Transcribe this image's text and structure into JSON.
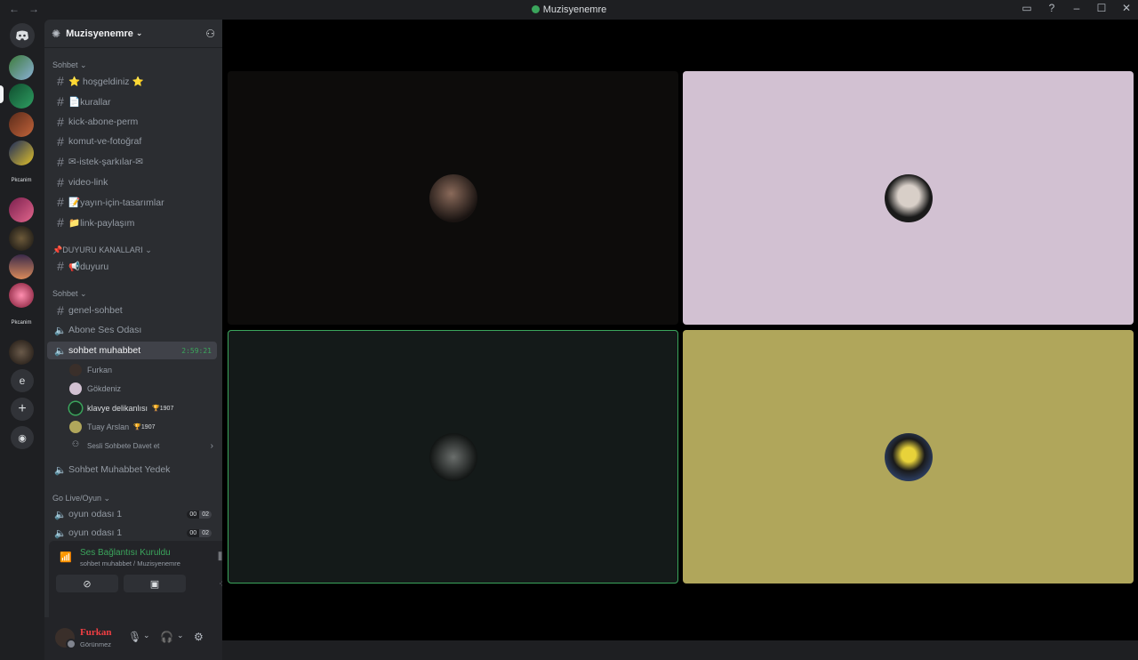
{
  "window": {
    "title": "Muzisyenemre",
    "back_icon": "←",
    "forward_icon": "→"
  },
  "server": {
    "name": "Muzisyenemre"
  },
  "rail": {
    "text_server_1": "Pkcanim",
    "text_server_2": "Pkcanim",
    "letter_server": "e",
    "add_icon": "+",
    "discover_icon": "◉"
  },
  "categories": {
    "sohbet1": "Sohbet ⌄",
    "duyuru": "📌DUYURU KANALLARI ⌄",
    "sohbet2": "Sohbet ⌄",
    "golive": "Go Live/Oyun ⌄"
  },
  "channels": [
    {
      "label": "⭐ hoşgeldiniz ⭐",
      "type": "text"
    },
    {
      "label": "📄kurallar",
      "type": "text"
    },
    {
      "label": "kick-abone-perm",
      "type": "text"
    },
    {
      "label": "komut-ve-fotoğraf",
      "type": "text"
    },
    {
      "label": "✉-istek-şarkılar-✉",
      "type": "text"
    },
    {
      "label": "video-link",
      "type": "text"
    },
    {
      "label": "📝yayın-için-tasarımlar",
      "type": "text"
    },
    {
      "label": "📁link-paylaşım",
      "type": "text"
    },
    {
      "label": "📢duyuru",
      "type": "text"
    },
    {
      "label": "genel-sohbet",
      "type": "text"
    },
    {
      "label": "Abone Ses Odası",
      "type": "voice"
    },
    {
      "label": "sohbet muhabbet",
      "type": "voice",
      "timer": "2:59:21"
    },
    {
      "label": "Sohbet Muhabbet Yedek",
      "type": "voice"
    },
    {
      "label": "oyun odası 1",
      "type": "voice",
      "badge_a": "00",
      "badge_b": "02"
    },
    {
      "label": "oyun odası 1",
      "type": "voice",
      "badge_a": "00",
      "badge_b": "02"
    }
  ],
  "voice_users": [
    {
      "name": "Furkan"
    },
    {
      "name": "Gökdeniz"
    },
    {
      "name": "klavye delikanlısı",
      "tag": "🏆1907"
    },
    {
      "name": "Tuay Arslan",
      "tag": "🏆1907"
    },
    {
      "name": "Sesli Sohbete Davet et"
    }
  ],
  "voice_panel": {
    "status": "Ses Bağlantısı Kuruldu",
    "sub": "sohbet muhabbet / Muzisyenemre"
  },
  "user": {
    "name": "Furkan",
    "status": "Görünmez"
  },
  "colors": {
    "accent_green": "#3ba55c",
    "tile_1": "#0d0c0b",
    "tile_2": "#d2c1d2",
    "tile_3": "#141a19",
    "tile_4": "#b0a65b"
  }
}
